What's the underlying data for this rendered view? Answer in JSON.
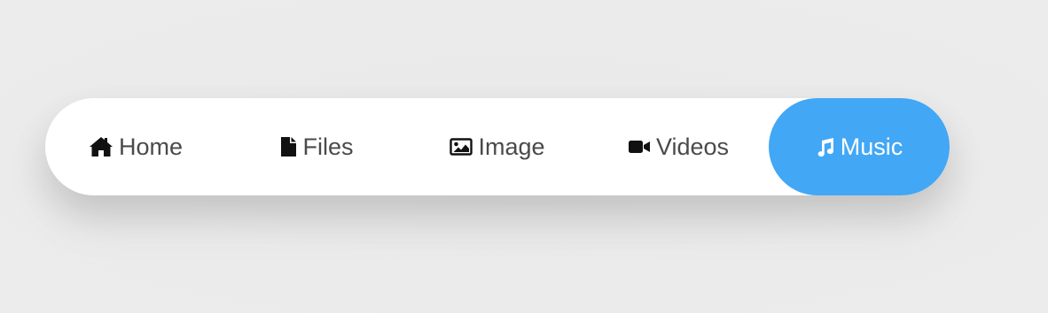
{
  "nav": {
    "items": [
      {
        "label": "Home",
        "icon": "home-icon",
        "active": false
      },
      {
        "label": "Files",
        "icon": "file-icon",
        "active": false
      },
      {
        "label": "Image",
        "icon": "image-icon",
        "active": false
      },
      {
        "label": "Videos",
        "icon": "video-camera-icon",
        "active": false
      },
      {
        "label": "Music",
        "icon": "music-note-icon",
        "active": true
      }
    ]
  },
  "colors": {
    "accent": "#42a7f5",
    "text": "#4a4a4a",
    "background": "#ebebeb",
    "bar": "#ffffff"
  }
}
